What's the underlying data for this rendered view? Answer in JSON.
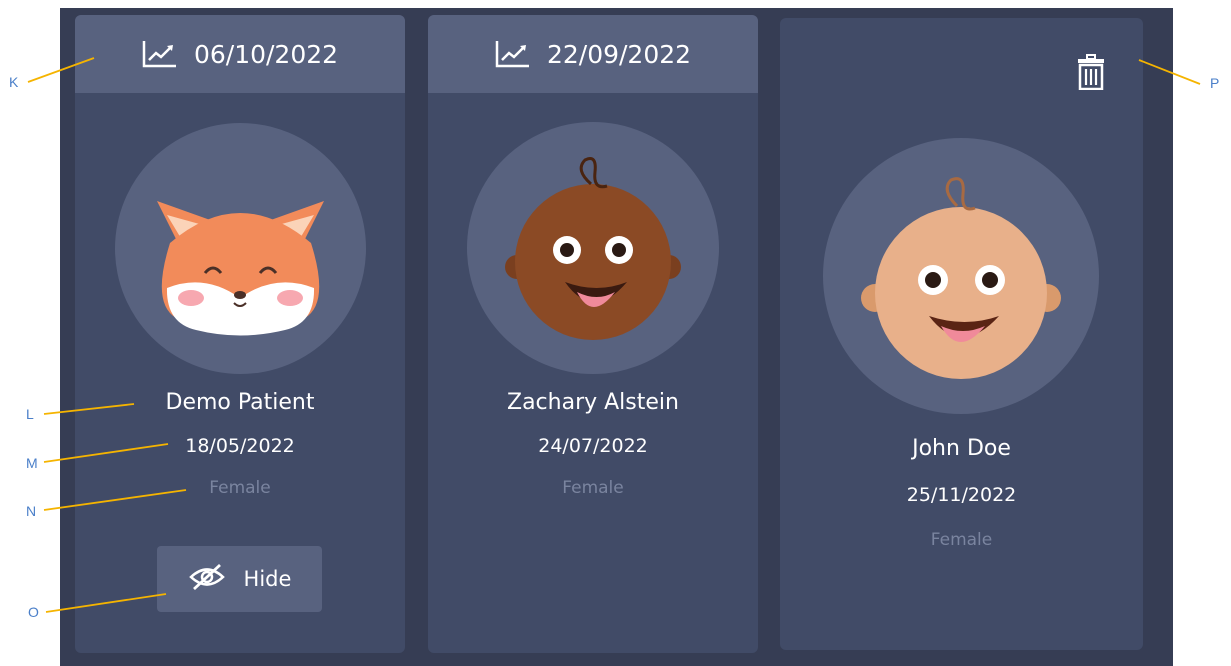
{
  "cards": [
    {
      "header_date": "06/10/2022",
      "name": "Demo Patient",
      "dob": "18/05/2022",
      "gender": "Female",
      "hide_label": "Hide",
      "avatar": "fox-avatar"
    },
    {
      "header_date": "22/09/2022",
      "name": "Zachary Alstein",
      "dob": "24/07/2022",
      "gender": "Female",
      "avatar": "baby-dark-avatar"
    },
    {
      "name": "John Doe",
      "dob": "25/11/2022",
      "gender": "Female",
      "avatar": "baby-light-avatar"
    }
  ],
  "icons": [
    "chart-icon",
    "eye-slash-icon",
    "trash-icon"
  ],
  "callouts": [
    "K",
    "L",
    "M",
    "N",
    "O",
    "P"
  ],
  "colors": {
    "panel": "#363d54",
    "card": "#414b67",
    "header": "#58627f",
    "callout_line": "#f5b400",
    "callout_text": "#4a7fc9"
  }
}
